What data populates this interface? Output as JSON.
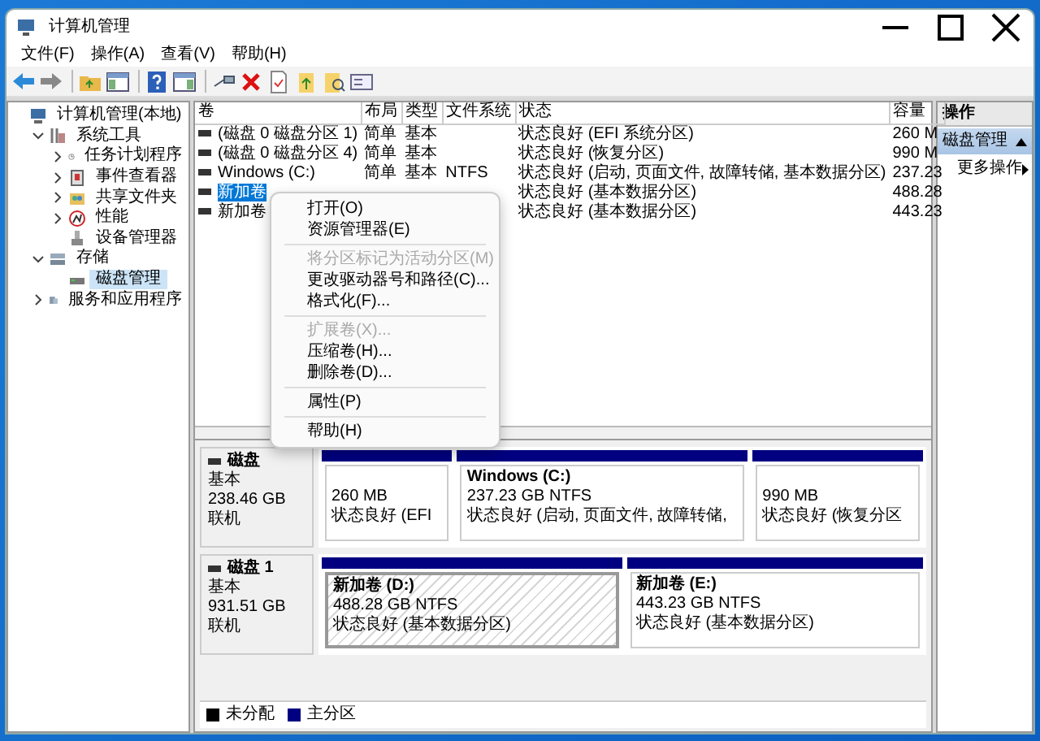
{
  "window": {
    "title": "计算机管理"
  },
  "menu_bar": [
    "文件(F)",
    "操作(A)",
    "查看(V)",
    "帮助(H)"
  ],
  "tree": [
    {
      "label": "计算机管理(本地)",
      "kind": "computer",
      "selected": false,
      "children": [
        {
          "label": "系统工具",
          "kind": "tools",
          "expanded": true,
          "selected": false,
          "children": [
            {
              "label": "任务计划程序",
              "kind": "clock",
              "expanded": false,
              "selected": false
            },
            {
              "label": "事件查看器",
              "kind": "event",
              "expanded": false,
              "selected": false
            },
            {
              "label": "共享文件夹",
              "kind": "share",
              "expanded": false,
              "selected": false
            },
            {
              "label": "性能",
              "kind": "perf",
              "expanded": false,
              "selected": false
            },
            {
              "label": "设备管理器",
              "kind": "device",
              "selected": false
            }
          ]
        },
        {
          "label": "存储",
          "kind": "storage",
          "expanded": true,
          "selected": false,
          "children": [
            {
              "label": "磁盘管理",
              "kind": "disk",
              "selected": true
            }
          ]
        },
        {
          "label": "服务和应用程序",
          "kind": "services",
          "expanded": false,
          "selected": false
        }
      ]
    }
  ],
  "volume_table": {
    "columns": [
      "卷",
      "布局",
      "类型",
      "文件系统",
      "状态",
      "容量"
    ],
    "rows": [
      {
        "volume": "(磁盘 0 磁盘分区 1)",
        "layout": "简单",
        "type": "基本",
        "status": "状态良好 (EFI 系统分区)",
        "capacity": "260 M",
        "selected": false
      },
      {
        "volume": "(磁盘 0 磁盘分区 4)",
        "layout": "简单",
        "type": "基本",
        "status": "状态良好 (恢复分区)",
        "capacity": "990 M",
        "selected": false
      },
      {
        "volume": "Windows (C:)",
        "layout": "简单",
        "type": "基本",
        "file_system": "NTFS",
        "status": "状态良好 (启动, 页面文件, 故障转储, 基本数据分区)",
        "capacity": "237.23",
        "selected": false
      },
      {
        "volume": "新加卷",
        "status": "状态良好 (基本数据分区)",
        "capacity": "488.28",
        "selected": true
      },
      {
        "volume": "新加卷",
        "status": "状态良好 (基本数据分区)",
        "capacity": "443.23",
        "selected": false
      }
    ]
  },
  "context_menu": [
    {
      "kind": "item",
      "label": "打开(O)",
      "disabled": false
    },
    {
      "kind": "item",
      "label": "资源管理器(E)",
      "disabled": false
    },
    {
      "kind": "separator"
    },
    {
      "kind": "item",
      "label": "将分区标记为活动分区(M)",
      "disabled": true
    },
    {
      "kind": "item",
      "label": "更改驱动器号和路径(C)...",
      "disabled": false
    },
    {
      "kind": "item",
      "label": "格式化(F)...",
      "disabled": false
    },
    {
      "kind": "separator"
    },
    {
      "kind": "item",
      "label": "扩展卷(X)...",
      "disabled": true
    },
    {
      "kind": "item",
      "label": "压缩卷(H)...",
      "disabled": false
    },
    {
      "kind": "item",
      "label": "删除卷(D)...",
      "disabled": false
    },
    {
      "kind": "separator"
    },
    {
      "kind": "item",
      "label": "属性(P)",
      "disabled": false
    },
    {
      "kind": "separator"
    },
    {
      "kind": "item",
      "label": "帮助(H)",
      "disabled": false
    }
  ],
  "disks": [
    {
      "label": "磁盘",
      "type": "基本",
      "size": "238.46 GB",
      "state": "联机",
      "partitions": [
        {
          "size": "260 MB",
          "status": "状态良好 (EFI",
          "selected": false
        },
        {
          "name": "Windows  (C:)",
          "size": "237.23 GB NTFS",
          "status": "状态良好 (启动, 页面文件, 故障转储,",
          "selected": false
        },
        {
          "size": "990 MB",
          "status": "状态良好 (恢复分区",
          "selected": false
        }
      ]
    },
    {
      "label": "磁盘 1",
      "type": "基本",
      "size": "931.51 GB",
      "state": "联机",
      "partitions": [
        {
          "name": "新加卷  (D:)",
          "size": "488.28 GB NTFS",
          "status": "状态良好 (基本数据分区)",
          "selected": true
        },
        {
          "name": "新加卷  (E:)",
          "size": "443.23 GB NTFS",
          "status": "状态良好 (基本数据分区)",
          "selected": false
        }
      ]
    }
  ],
  "legend": [
    {
      "label": "未分配",
      "color": "#000000"
    },
    {
      "label": "主分区",
      "color": "#000080"
    }
  ],
  "actions": {
    "title": "操作",
    "section": {
      "label": "磁盘管理",
      "expanded": true
    },
    "items": [
      {
        "label": "更多操作"
      }
    ]
  }
}
